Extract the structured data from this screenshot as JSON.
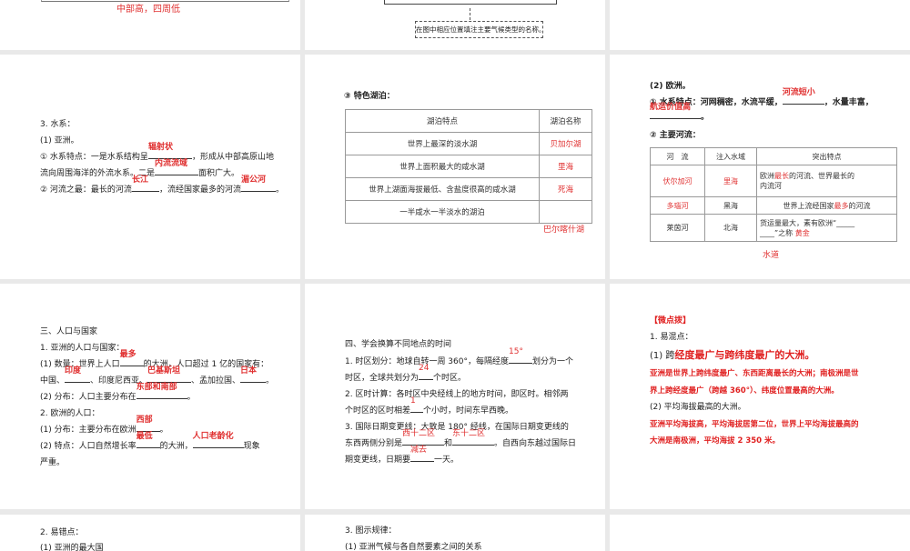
{
  "slides": {
    "s1": {
      "answer": "中部高，四周低"
    },
    "s2": {
      "caption": "在图中相应位置填注主要气候类型的名称。"
    },
    "s4": {
      "title": "3. 水系：",
      "sub": "(1) 亚洲。",
      "l1a": "① 水系特点：一是水系结构呈",
      "l1ans": "辐射状",
      "l1b": "，形成从中部高原山地",
      "l2a": "流向周围海洋的外流水系。二是",
      "l2ans": "内流流域",
      "l2b": "面积广大。",
      "l3a": "② 河流之最：最长的河流",
      "l3ans1": "长江",
      "l3b": "，流经国家最多的河流",
      "l3ans2": "湄公河",
      "l3c": "。"
    },
    "s5": {
      "title": "③ 特色湖泊：",
      "headers": [
        "湖泊特点",
        "湖泊名称"
      ],
      "rows": [
        {
          "feature": "世界上最深的淡水湖",
          "name": "贝加尔湖"
        },
        {
          "feature": "世界上面积最大的咸水湖",
          "name": "里海"
        },
        {
          "feature": "世界上湖面海拔最低、含盐度很高的咸水湖",
          "name": "死海"
        },
        {
          "feature": "一半咸水一半淡水的湖泊",
          "name": "巴尔喀什湖"
        }
      ]
    },
    "s6": {
      "title": "(2) 欧洲。",
      "l1a": "① 水系特点：河网稠密，水流平缓，",
      "l1ans": "河流短小",
      "l1b": "，水量丰富，",
      "l2ans": "航运价值高",
      "l2b": "。",
      "sub": "② 主要河流：",
      "headers": [
        "河　流",
        "注入水域",
        "突出特点"
      ],
      "r1": {
        "river": "伏尔加河",
        "sea": "里海",
        "a": "欧洲",
        "ans": "最长",
        "b": "的河流、世界最长的",
        "c": "内流河"
      },
      "r2": {
        "river": "多瑙河",
        "sea": "黑海",
        "a": "世界上流经国家",
        "ans": "最多",
        "b": "的河流"
      },
      "r3": {
        "river": "莱茵河",
        "sea": "北海",
        "a": "货运量最大，素有欧洲“",
        "b": "”之称",
        "ans1": "黄金",
        "ans2": "水道"
      }
    },
    "s7": {
      "title": "三、人口与国家",
      "h1": "1. 亚洲的人口与国家：",
      "l1a": "(1) 数量：世界上人口",
      "l1ans": "最多",
      "l1b": "的大洲，人口超过 1 亿的国家有：",
      "l2a": "中国、",
      "l2ans1": "印度",
      "l2b": "、印度尼西亚、",
      "l2ans2": "巴基斯坦",
      "l2c": "、孟加拉国、",
      "l2ans3": "日本",
      "l2d": "。",
      "l3a": "(2) 分布：人口主要分布在",
      "l3ans": "东部和南部",
      "l3b": "。",
      "h2": "2. 欧洲的人口：",
      "l4a": "(1) 分布：主要分布在欧洲",
      "l4ans": "西部",
      "l4b": "。",
      "l5a": "(2) 特点：人口自然增长率",
      "l5ans1": "最低",
      "l5b": "的大洲，",
      "l5ans2": "人口老龄化",
      "l5c": "现象",
      "l6": "严重。"
    },
    "s8": {
      "title": "四、学会换算不同地点的时间",
      "l1a": "1. 时区划分：地球自转一周 360°，每隔经度",
      "l1ans": "15°",
      "l1b": "划分为一个",
      "l2a": "时区，全球共划分为",
      "l2ans": "24",
      "l2b": "个时区。",
      "l3": "2. 区时计算：各时区中央经线上的地方时间，即区时。相邻两",
      "l4a": "个时区的区时相差",
      "l4ans": "1",
      "l4b": "个小时，时间东早西晚。",
      "l5": "3. 国际日期变更线：大致是 180° 经线，在国际日期变更线的",
      "l6a": "东西两侧分别是",
      "l6ans1": "西十二区",
      "l6b": "和",
      "l6ans2": "东十二区",
      "l6c": "。自西向东越过国际日",
      "l7a": "期变更线，日期要",
      "l7ans": "减去",
      "l7b": "一天。"
    },
    "s9": {
      "tag": "【微点拨】",
      "h1": "1. 易混点：",
      "p1a": "(1) 跨",
      "p1b": "经度最广与跨纬度最广的大洲。",
      "r1": "亚洲是世界上跨纬度最广、东西距离最长的大洲；南极洲是世",
      "r2": "界上跨经度最广（跨越 360°）、纬度位置最高的大洲。",
      "p2": "(2) 平均海拔最高的大洲。",
      "r3": "亚洲平均海拔高，平均海拔居第二位，世界上平均海拔最高的",
      "r4": "大洲是南极洲，平均海拔 2 350 米。"
    },
    "s10": {
      "title": "2. 易错点：",
      "line2": "(1) 亚洲的最大国"
    },
    "s11": {
      "title": "3. 图示规律：",
      "line2": "(1) 亚洲气候与各自然要素之间的关系"
    }
  }
}
